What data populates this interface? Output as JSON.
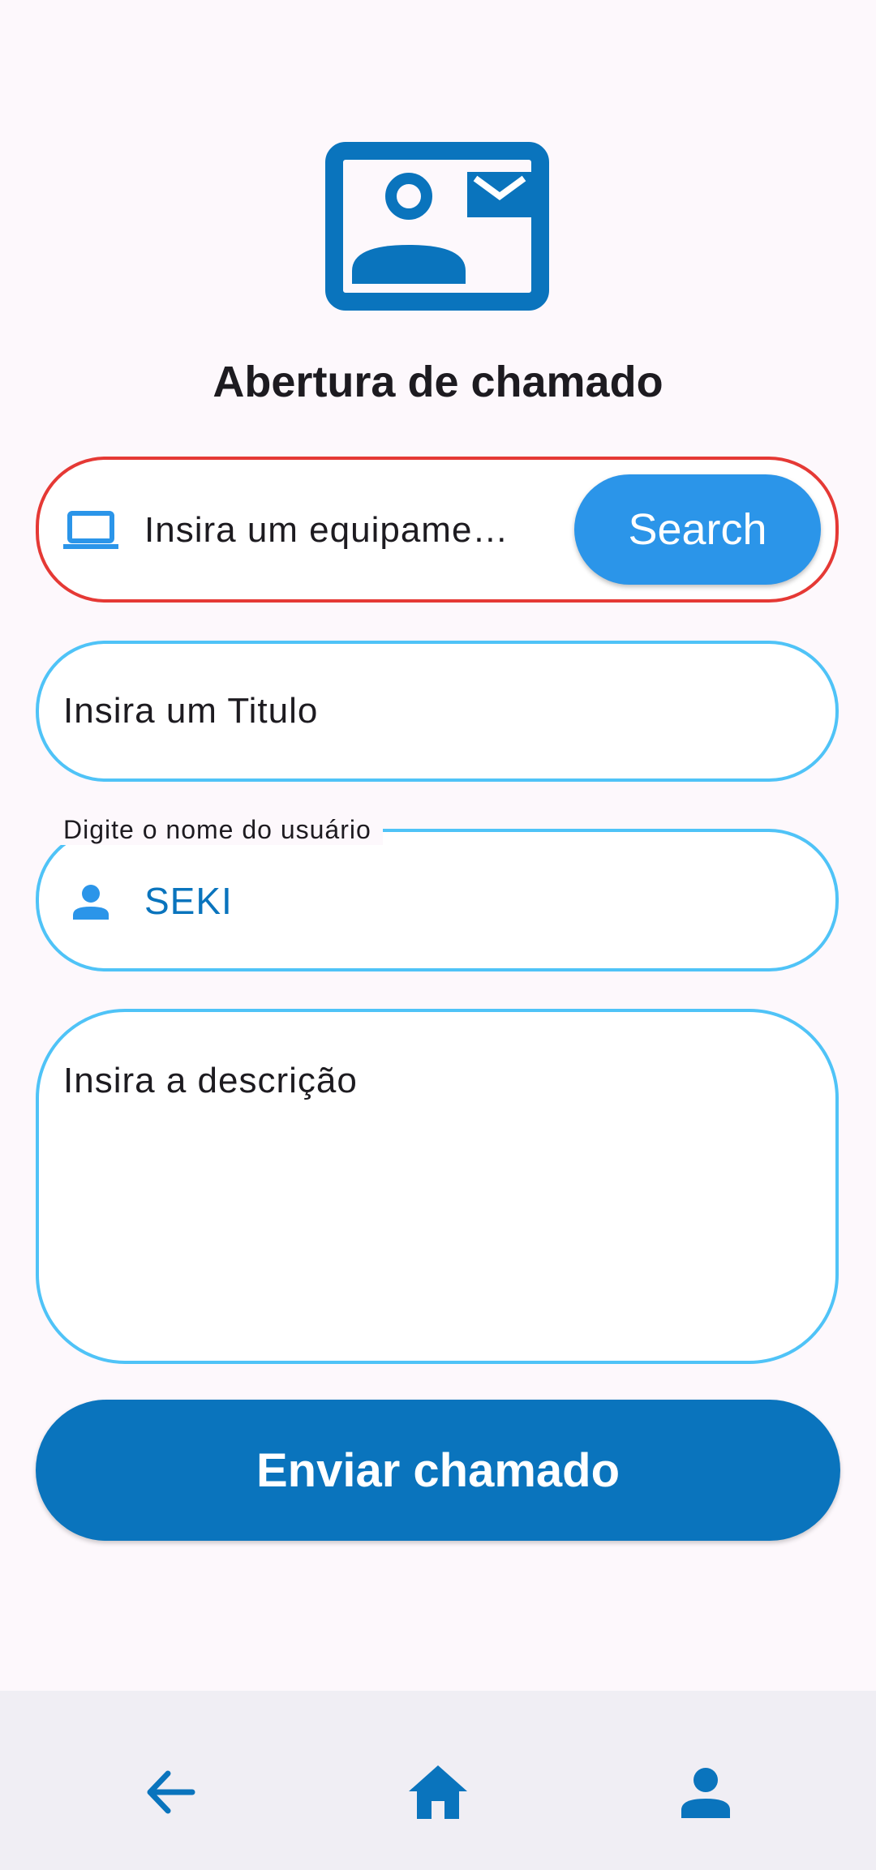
{
  "header": {
    "logo_icon": "contact-mail-icon",
    "title": "Abertura de chamado"
  },
  "form": {
    "equipment": {
      "icon": "laptop-icon",
      "placeholder": "Insira um equipame…",
      "search_label": "Search",
      "border_color": "#e53935"
    },
    "title_field": {
      "placeholder": "Insira um Titulo"
    },
    "user_field": {
      "label": "Digite o nome do usuário",
      "icon": "person-icon",
      "value": "SEKI"
    },
    "description_field": {
      "placeholder": "Insira a descrição"
    },
    "submit_label": "Enviar chamado"
  },
  "bottom_nav": {
    "items": [
      {
        "icon": "arrow-back-icon"
      },
      {
        "icon": "home-icon"
      },
      {
        "icon": "person-icon"
      }
    ]
  },
  "colors": {
    "primary": "#0a74bd",
    "accent_blue": "#2b95e9",
    "field_border": "#4fc3f7",
    "error_border": "#e53935",
    "background": "#fdf8fc"
  }
}
